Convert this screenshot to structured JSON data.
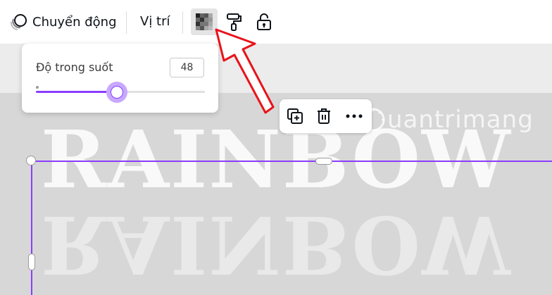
{
  "toolbar": {
    "animate_label": "Chuyển động",
    "position_label": "Vị trí",
    "icons": {
      "animate": "animate-circles-icon",
      "transparency": "transparency-checker-icon",
      "paint_format": "paint-roller-icon",
      "lock": "unlock-icon"
    }
  },
  "transparency_popover": {
    "label": "Độ trong suốt",
    "value": "48",
    "slider_fraction": 0.48
  },
  "element_toolbar": {
    "icons": {
      "duplicate": "duplicate-icon",
      "delete": "trash-icon",
      "more": "more-dots-icon"
    }
  },
  "canvas": {
    "text": "RAINBOW",
    "reflection_text": "RAINBOW",
    "watermark_text": "uantrimang"
  },
  "colors": {
    "accent": "#8b3dff",
    "arrow": "#e8131b",
    "canvas_bg": "#d7d7d7"
  }
}
